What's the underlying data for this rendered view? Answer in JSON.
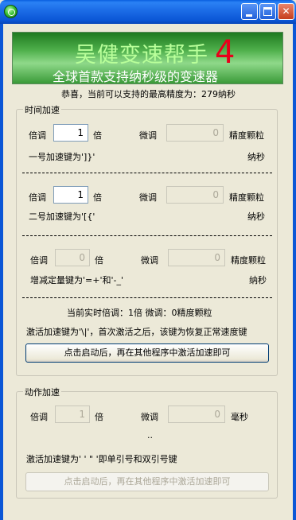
{
  "window": {
    "title": ""
  },
  "banner": {
    "title": "吴健变速帮手",
    "version": "4",
    "subtitle": "全球首款支持纳秒级的变速器"
  },
  "precision_line": "恭喜，当前可以支持的最高精度为：279纳秒",
  "time_group": {
    "legend": "时间加速",
    "rows": [
      {
        "mult_label": "倍调",
        "mult_value": "1",
        "mult_unit": "倍",
        "fine_label": "微调",
        "fine_value": "0",
        "fine_unit": "精度颗粒",
        "hotkey": "一号加速键为']}'",
        "hotkey_unit": "纳秒"
      },
      {
        "mult_label": "倍调",
        "mult_value": "1",
        "mult_unit": "倍",
        "fine_label": "微调",
        "fine_value": "0",
        "fine_unit": "精度颗粒",
        "hotkey": "二号加速键为'[{'",
        "hotkey_unit": "纳秒"
      },
      {
        "mult_label": "倍调",
        "mult_value": "0",
        "mult_unit": "倍",
        "fine_label": "微调",
        "fine_value": "0",
        "fine_unit": "精度颗粒",
        "hotkey": "增减定量键为'=+'和'-_'",
        "hotkey_unit": "纳秒"
      }
    ],
    "current_rate": "当前实时倍调：1倍  微调：0精度颗粒",
    "activate_note": "激活加速键为'\\|'，首次激活之后，该键为恢复正常速度键",
    "start_button": "点击启动后，再在其他程序中激活加速即可"
  },
  "action_group": {
    "legend": "动作加速",
    "mult_label": "倍调",
    "mult_value": "1",
    "mult_unit": "倍",
    "fine_label": "微调",
    "fine_value": "0",
    "fine_unit": "毫秒",
    "dots": "..",
    "activate_note": "激活加速键为' ' \" '即单引号和双引号键",
    "start_button": "点击启动后，再在其他程序中激活加速即可"
  }
}
